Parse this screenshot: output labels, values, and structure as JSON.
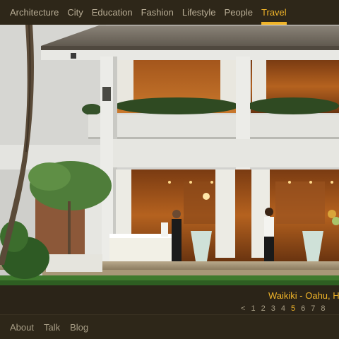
{
  "nav": {
    "items": [
      {
        "label": "Architecture",
        "active": false
      },
      {
        "label": "City",
        "active": false
      },
      {
        "label": "Education",
        "active": false
      },
      {
        "label": "Fashion",
        "active": false
      },
      {
        "label": "Lifestyle",
        "active": false
      },
      {
        "label": "People",
        "active": false
      },
      {
        "label": "Travel",
        "active": true
      }
    ]
  },
  "caption": {
    "title": "Waikiki - Oahu, H"
  },
  "pager": {
    "prev": "<",
    "pages": [
      "1",
      "2",
      "3",
      "4",
      "5",
      "6",
      "7",
      "8"
    ],
    "current": "5"
  },
  "footer": {
    "links": [
      "About",
      "Talk",
      "Blog"
    ]
  },
  "colors": {
    "accent": "#f0b429",
    "nav_text": "#b8ad95",
    "background": "#2b2418"
  }
}
